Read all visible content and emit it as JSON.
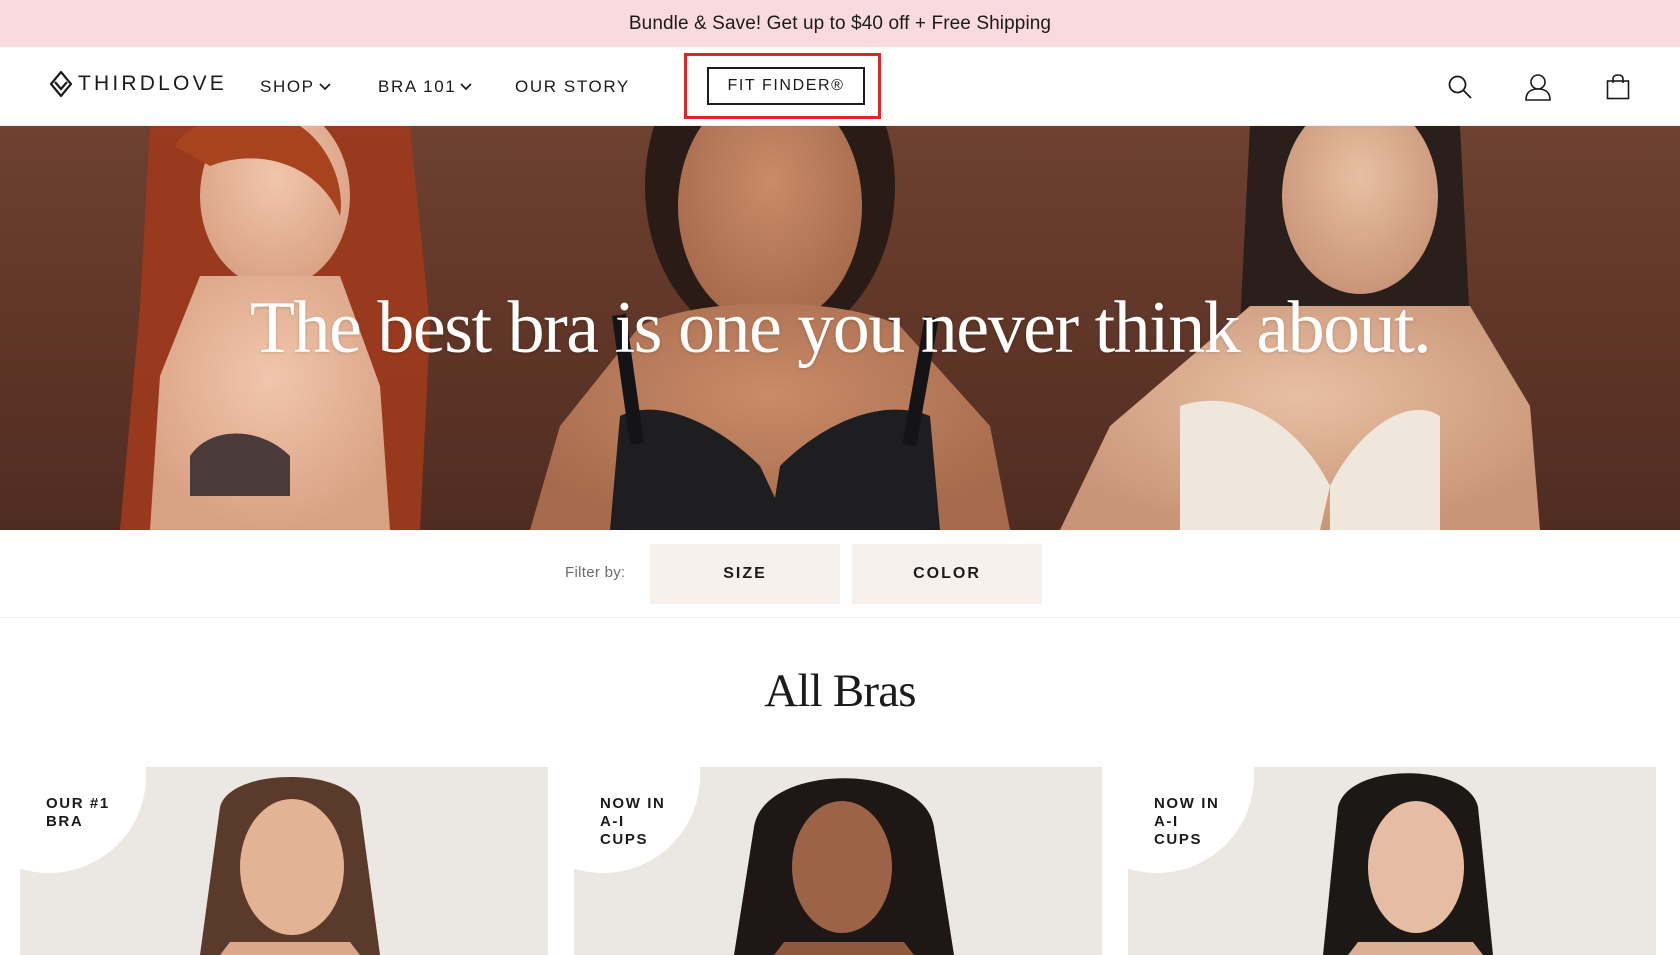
{
  "promo": {
    "text": "Bundle & Save! Get up to $40 off + Free Shipping"
  },
  "header": {
    "logo": {
      "text": "THIRDLOVE",
      "icon": "thirdlove-diamond-logo"
    },
    "nav": [
      {
        "label": "SHOP",
        "has_dropdown": true
      },
      {
        "label": "BRA 101",
        "has_dropdown": true
      },
      {
        "label": "OUR STORY",
        "has_dropdown": false
      }
    ],
    "fit_finder_label": "FIT FINDER®",
    "icons": [
      "search-icon",
      "account-icon",
      "cart-icon"
    ],
    "highlight_color": "#e02626"
  },
  "hero": {
    "title": "The best bra is one you never think about."
  },
  "filter": {
    "label": "Filter by:",
    "buttons": [
      "SIZE",
      "COLOR"
    ]
  },
  "section": {
    "title": "All Bras"
  },
  "products": [
    {
      "badge_lines": [
        "OUR #1",
        "BRA"
      ]
    },
    {
      "badge_lines": [
        "NOW IN",
        "A-I",
        "CUPS"
      ]
    },
    {
      "badge_lines": [
        "NOW IN",
        "A-I",
        "CUPS"
      ]
    }
  ],
  "colors": {
    "promo_bg": "#f9dbdd",
    "hero_bg": "#5e3527",
    "filter_btn_bg": "#f6f1ec",
    "text": "#1b1b1b"
  }
}
